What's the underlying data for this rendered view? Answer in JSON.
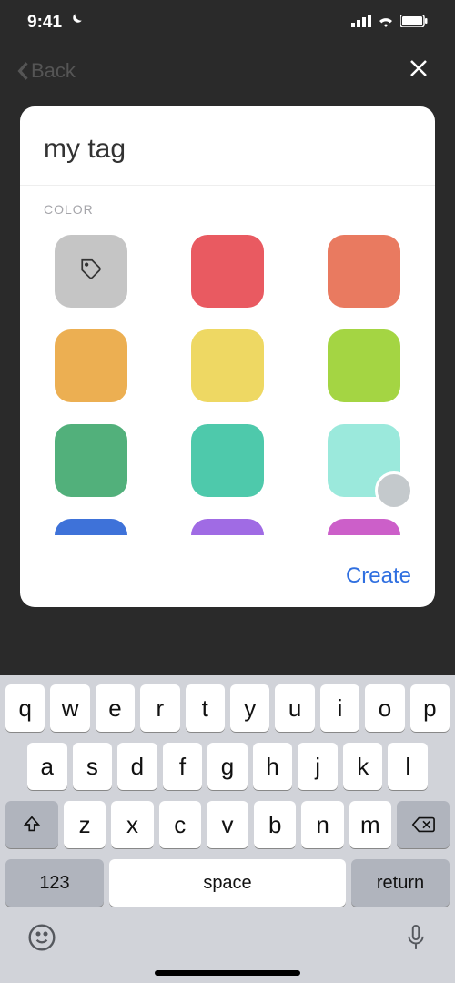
{
  "status": {
    "time": "9:41",
    "dnd": true
  },
  "dim_header": {
    "back": "Back"
  },
  "modal": {
    "tag_name": "my tag",
    "section_label": "COLOR",
    "create_label": "Create",
    "swatches": {
      "row1": [
        "#c5c5c5",
        "#e95a61",
        "#e97a60"
      ],
      "row2": [
        "#ecaf52",
        "#eed863",
        "#a4d543"
      ],
      "row3": [
        "#52b07b",
        "#4ec9ab",
        "#9be9dc"
      ],
      "row4": [
        "#3e72d9",
        "#a06be4",
        "#cc5fc9"
      ]
    }
  },
  "keyboard": {
    "row1": [
      "q",
      "w",
      "e",
      "r",
      "t",
      "y",
      "u",
      "i",
      "o",
      "p"
    ],
    "row2": [
      "a",
      "s",
      "d",
      "f",
      "g",
      "h",
      "j",
      "k",
      "l"
    ],
    "row3": [
      "z",
      "x",
      "c",
      "v",
      "b",
      "n",
      "m"
    ],
    "numbers": "123",
    "space": "space",
    "return": "return"
  }
}
